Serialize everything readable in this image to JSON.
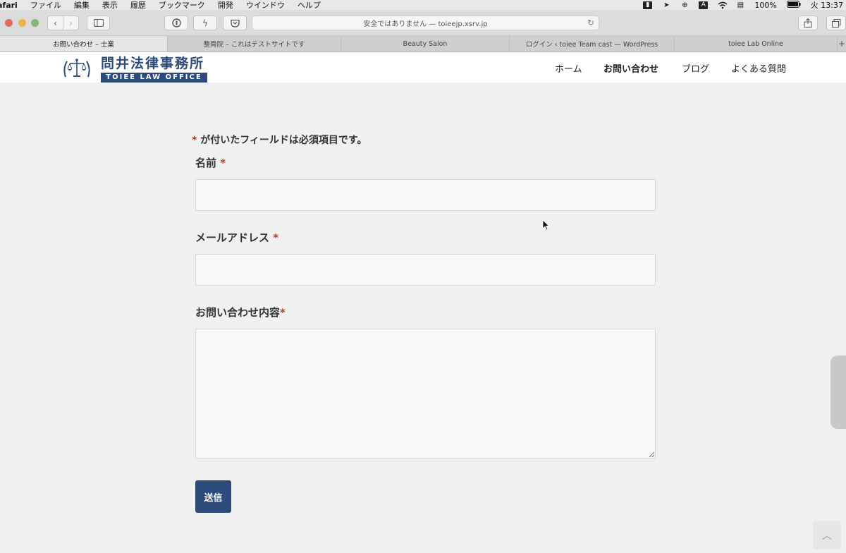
{
  "menubar": {
    "app": "afari",
    "items": [
      "ファイル",
      "編集",
      "表示",
      "履歴",
      "ブックマーク",
      "開発",
      "ウインドウ",
      "ヘルプ"
    ],
    "battery": "100%",
    "clock": "火 13:37"
  },
  "toolbar": {
    "address": "安全ではありません — toieejp.xsrv.jp",
    "back_icon": "chevron-left-icon",
    "forward_icon": "chevron-right-icon"
  },
  "tabs": [
    {
      "label": "お問い合わせ – 士業",
      "active": true
    },
    {
      "label": "整骨院 – これはテストサイトです",
      "active": false
    },
    {
      "label": "Beauty Salon",
      "active": false
    },
    {
      "label": "ログイン ‹ toiee Team cast — WordPress",
      "active": false
    },
    {
      "label": "toiee Lab Online",
      "active": false
    }
  ],
  "site": {
    "logo_jp": "問井法律事務所",
    "logo_en": "TOIEE LAW OFFICE",
    "brand_color": "#2c4a7a",
    "nav": {
      "home": "ホーム",
      "contact": "お問い合わせ",
      "blog": "ブログ",
      "faq": "よくある質問"
    }
  },
  "form": {
    "required_mark": "*",
    "required_note": " が付いたフィールドは必須項目です。",
    "name_label": "名前",
    "email_label": "メールアドレス",
    "message_label": "お問い合わせ内容",
    "name_value": "",
    "email_value": "",
    "message_value": "",
    "submit_label": "送信"
  }
}
